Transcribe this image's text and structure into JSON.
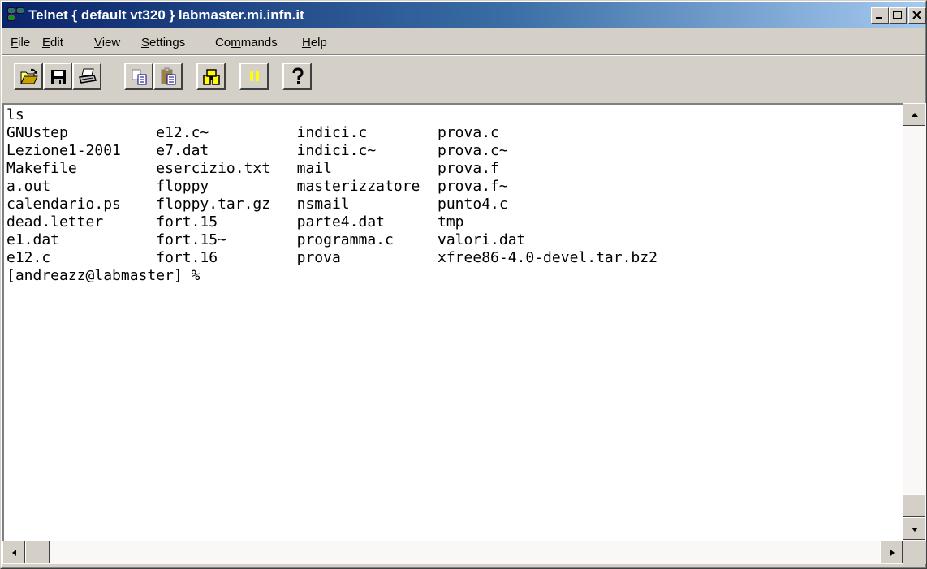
{
  "window": {
    "title": "Telnet { default vt320 } labmaster.mi.infn.it"
  },
  "menu": [
    {
      "label": "File",
      "accel": "F",
      "rest": "ile"
    },
    {
      "label": "Edit",
      "accel": "E",
      "rest": "dit"
    },
    {
      "label": "View",
      "accel": "V",
      "rest": "iew"
    },
    {
      "label": "Settings",
      "accel": "S",
      "rest": "ettings"
    },
    {
      "label": "Commands",
      "pre": "Co",
      "accel": "m",
      "rest": "mands"
    },
    {
      "label": "Help",
      "accel": "H",
      "rest": "elp"
    }
  ],
  "toolbar": {
    "buttons": [
      {
        "name": "open-button",
        "icon": "folder-open-icon"
      },
      {
        "name": "save-button",
        "icon": "floppy-disk-icon"
      },
      {
        "name": "print-button",
        "icon": "printer-icon"
      },
      {
        "name": "copy-button",
        "icon": "copy-icon"
      },
      {
        "name": "paste-button",
        "icon": "paste-icon"
      },
      {
        "name": "find-button",
        "icon": "binoculars-icon"
      },
      {
        "name": "pause-button",
        "icon": "pause-icon"
      },
      {
        "name": "help-button",
        "icon": "question-mark-icon"
      }
    ]
  },
  "terminal": {
    "lines": [
      "ls",
      "GNUstep          e12.c~          indici.c        prova.c",
      "Lezione1-2001    e7.dat          indici.c~       prova.c~",
      "Makefile         esercizio.txt   mail            prova.f",
      "a.out            floppy          masterizzatore  prova.f~",
      "calendario.ps    floppy.tar.gz   nsmail          punto4.c",
      "dead.letter      fort.15         parte4.dat      tmp",
      "e1.dat           fort.15~        programma.c     valori.dat",
      "e12.c            fort.16         prova           xfree86-4.0-devel.tar.bz2",
      "[andreazz@labmaster] %"
    ]
  }
}
